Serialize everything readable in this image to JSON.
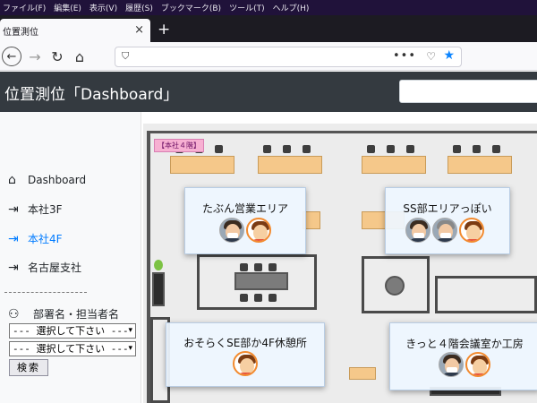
{
  "browser": {
    "menu": [
      "ファイル(F)",
      "編集(E)",
      "表示(V)",
      "履歴(S)",
      "ブックマーク(B)",
      "ツール(T)",
      "ヘルプ(H)"
    ],
    "tab_title": "位置測位",
    "tab_close": "×",
    "new_tab": "+",
    "url": ""
  },
  "app": {
    "title": "位置測位「Dashboard」",
    "header_search_value": ""
  },
  "sidebar": {
    "items": [
      {
        "label": "Dashboard",
        "icon": "home-icon",
        "glyph": "⌂",
        "active": false
      },
      {
        "label": "本社3F",
        "icon": "sign-in-icon",
        "glyph": "⇥",
        "active": false
      },
      {
        "label": "本社4F",
        "icon": "sign-in-icon",
        "glyph": "⇥",
        "active": true
      },
      {
        "label": "名古屋支社",
        "icon": "sign-in-icon",
        "glyph": "⇥",
        "active": false
      }
    ],
    "filter_label": "部署名・担当者名",
    "filter_icon": "users-icon",
    "select_department": "--- 選択して下さい ---",
    "select_person": "--- 選択して下さい ---",
    "search_button": "検索"
  },
  "map": {
    "floor_badge": "【本社４階】",
    "areas": [
      {
        "title": "たぶん営業エリア",
        "people": [
          "photo",
          "cartoon"
        ]
      },
      {
        "title": "SS部エリアっぽい",
        "people": [
          "photo",
          "photo",
          "cartoon"
        ]
      },
      {
        "title": "おそらくSE部か4F休憩所",
        "people": [
          "cartoon"
        ]
      },
      {
        "title": "きっと４階会議室か工房",
        "people": [
          "photo",
          "cartoon"
        ]
      }
    ]
  },
  "colors": {
    "menubar": "#20123a",
    "app_header": "#343a40",
    "active_link": "#007bff",
    "floor_badge": "#f7b0d2",
    "desk": "#f5c88a"
  }
}
